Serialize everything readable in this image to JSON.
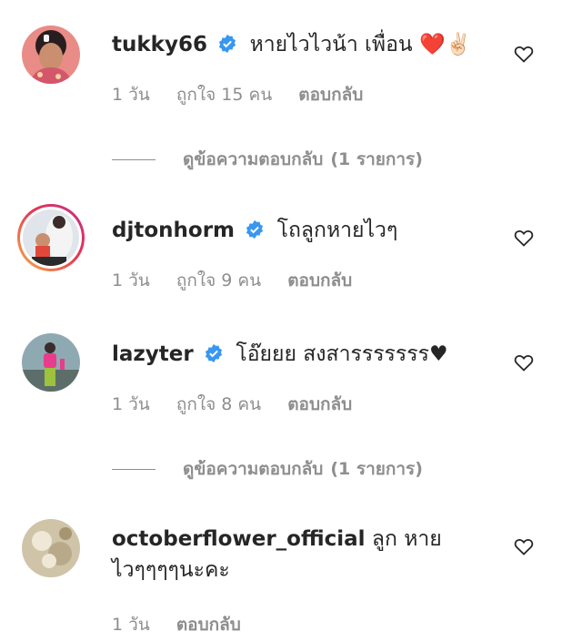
{
  "comments": [
    {
      "username": "tukky66",
      "verified": true,
      "text": "หายไวไวน้า เพื่อน",
      "emoji": "❤️✌🏻",
      "time": "1 วัน",
      "likes": "ถูกใจ 15 คน",
      "reply": "ตอบกลับ",
      "view_replies": {
        "label": "ดูข้อความตอบกลับ",
        "count": "(1 รายการ)"
      }
    },
    {
      "username": "djtonhorm",
      "verified": true,
      "text": "โถลูกหายไวๆ",
      "time": "1 วัน",
      "likes": "ถูกใจ 9 คน",
      "reply": "ตอบกลับ"
    },
    {
      "username": "lazyter",
      "verified": true,
      "text": "โอ๊ยยย สงสารรรรรรร♥",
      "time": "1 วัน",
      "likes": "ถูกใจ 8 คน",
      "reply": "ตอบกลับ",
      "view_replies": {
        "label": "ดูข้อความตอบกลับ",
        "count": "(1 รายการ)"
      }
    },
    {
      "username": "octoberflower_official",
      "verified": false,
      "text": "ลูก หายไวๆๆๆๆนะคะ",
      "time": "1 วัน",
      "reply": "ตอบกลับ"
    }
  ],
  "icons": {
    "verified": "verified-badge-icon",
    "like": "heart-outline-icon"
  },
  "colors": {
    "verified": "#3897f0",
    "meta_text": "#8e8e8e",
    "heart_emoji": "#e0162b"
  }
}
